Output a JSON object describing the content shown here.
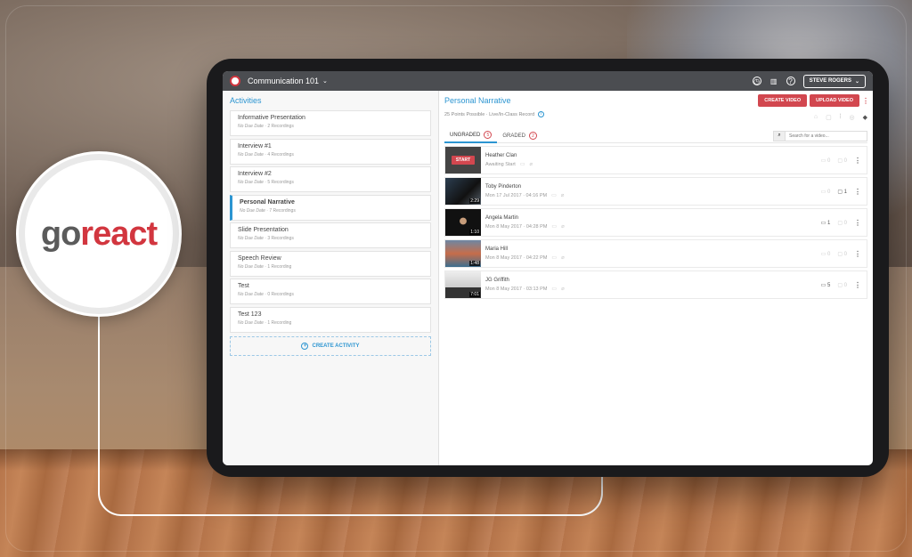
{
  "topbar": {
    "course": "Communication 101",
    "user": "STEVE ROGERS"
  },
  "left": {
    "title": "Activities",
    "activities": [
      {
        "name": "Informative Presentation",
        "due": "No Due Date",
        "recordings": "2 Recordings"
      },
      {
        "name": "Interview #1",
        "due": "No Due Date",
        "recordings": "4 Recordings"
      },
      {
        "name": "Interview #2",
        "due": "No Due Date",
        "recordings": "5 Recordings"
      },
      {
        "name": "Personal Narrative",
        "due": "No Due Date",
        "recordings": "7 Recordings"
      },
      {
        "name": "Slide Presentation",
        "due": "No Due Date",
        "recordings": "3 Recordings"
      },
      {
        "name": "Speech Review",
        "due": "No Due Date",
        "recordings": "1 Recording"
      },
      {
        "name": "Test",
        "due": "No Due Date",
        "recordings": "0 Recordings"
      },
      {
        "name": "Test 123",
        "due": "No Due Date",
        "recordings": "1 Recording"
      }
    ],
    "create_label": "CREATE ACTIVITY"
  },
  "right": {
    "title": "Personal Narrative",
    "create_video": "CREATE VIDEO",
    "upload_video": "UPLOAD VIDEO",
    "subtitle": "25 Points Possible · Live/In-Class Record",
    "tabs": {
      "ungraded": "UNGRADED",
      "ungraded_count": "5",
      "graded": "GRADED",
      "graded_count": "2"
    },
    "search_placeholder": "Search for a video...",
    "videos": [
      {
        "name": "Heather Clan",
        "date": "Awaiting Start",
        "thumb_label": "START",
        "comments": "0",
        "feedback": "0"
      },
      {
        "name": "Toby Pinderton",
        "date": "Mon 17 Jul 2017 · 04:16 PM",
        "duration": "2:29",
        "comments": "0",
        "feedback": "1"
      },
      {
        "name": "Angela Martin",
        "date": "Mon 8 May 2017 · 04:28 PM",
        "duration": "1:10",
        "comments": "1",
        "feedback": "0"
      },
      {
        "name": "Maria Hill",
        "date": "Mon 8 May 2017 · 04:22 PM",
        "duration": "1:48",
        "comments": "0",
        "feedback": "0"
      },
      {
        "name": "JG Griffith",
        "date": "Mon 8 May 2017 · 03:13 PM",
        "duration": "7:01",
        "comments": "5",
        "feedback": "0"
      }
    ]
  },
  "brand": {
    "logo_go": "go",
    "logo_react": "react",
    "accent": "#d2363f",
    "blue": "#2c95d1"
  }
}
